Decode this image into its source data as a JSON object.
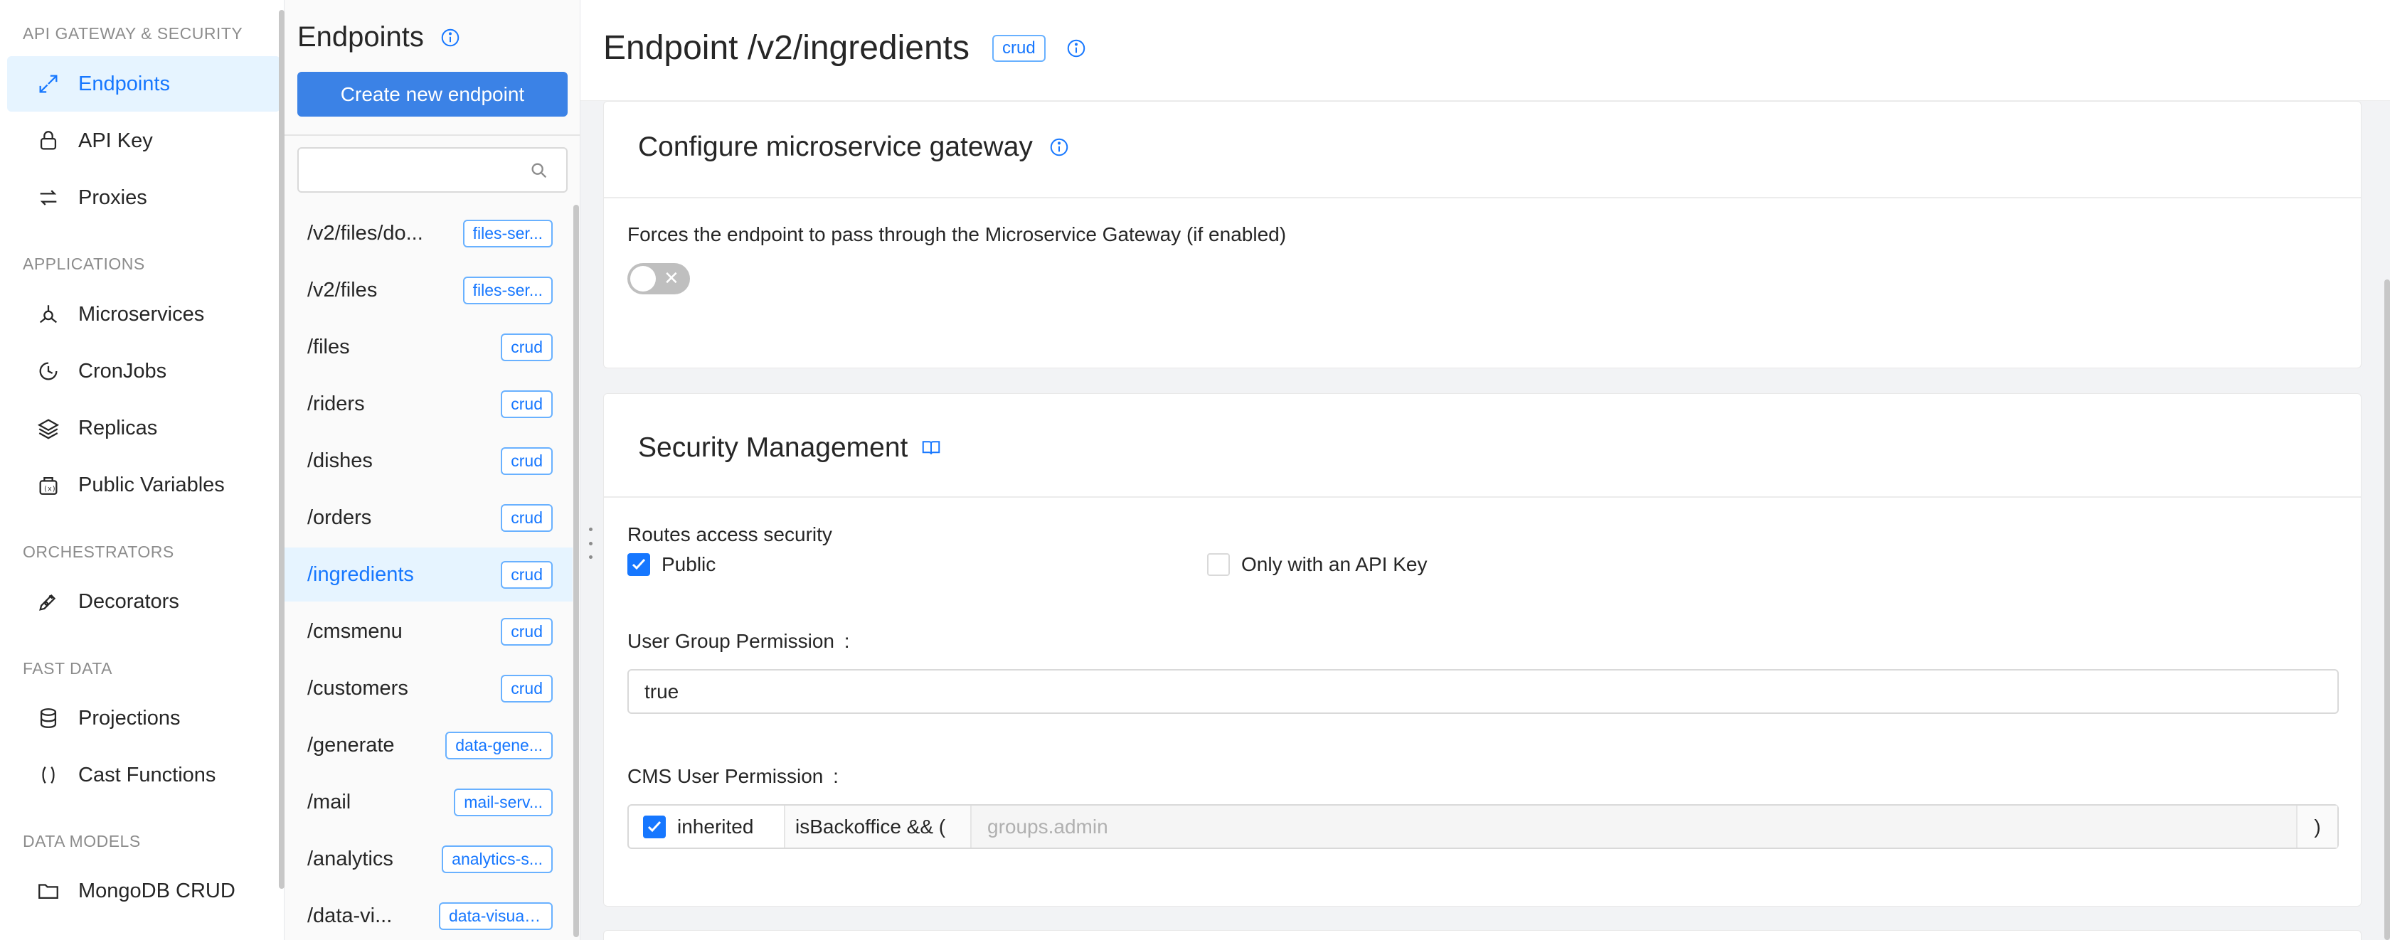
{
  "sidebar": {
    "sections": [
      {
        "title": "API GATEWAY & SECURITY",
        "items": [
          {
            "label": "Endpoints",
            "icon": "endpoints-icon",
            "active": true
          },
          {
            "label": "API Key",
            "icon": "lock-icon"
          },
          {
            "label": "Proxies",
            "icon": "proxies-icon"
          }
        ]
      },
      {
        "title": "APPLICATIONS",
        "items": [
          {
            "label": "Microservices",
            "icon": "microservices-icon"
          },
          {
            "label": "CronJobs",
            "icon": "clock-icon"
          },
          {
            "label": "Replicas",
            "icon": "layers-icon"
          },
          {
            "label": "Public Variables",
            "icon": "variables-icon"
          }
        ]
      },
      {
        "title": "ORCHESTRATORS",
        "items": [
          {
            "label": "Decorators",
            "icon": "pen-icon"
          }
        ]
      },
      {
        "title": "FAST DATA",
        "items": [
          {
            "label": "Projections",
            "icon": "database-icon"
          },
          {
            "label": "Cast Functions",
            "icon": "parentheses-icon"
          }
        ]
      },
      {
        "title": "DATA MODELS",
        "items": [
          {
            "label": "MongoDB CRUD",
            "icon": "folder-icon"
          }
        ]
      }
    ]
  },
  "endpoints_panel": {
    "title": "Endpoints",
    "create_button": "Create new endpoint",
    "search_placeholder": "",
    "items": [
      {
        "path": "/v2/files/do...",
        "tag": "files-ser..."
      },
      {
        "path": "/v2/files",
        "tag": "files-ser..."
      },
      {
        "path": "/files",
        "tag": "crud"
      },
      {
        "path": "/riders",
        "tag": "crud"
      },
      {
        "path": "/dishes",
        "tag": "crud"
      },
      {
        "path": "/orders",
        "tag": "crud"
      },
      {
        "path": "/ingredients",
        "tag": "crud",
        "active": true
      },
      {
        "path": "/cmsmenu",
        "tag": "crud"
      },
      {
        "path": "/customers",
        "tag": "crud"
      },
      {
        "path": "/generate",
        "tag": "data-gene..."
      },
      {
        "path": "/mail",
        "tag": "mail-serv..."
      },
      {
        "path": "/analytics",
        "tag": "analytics-s..."
      },
      {
        "path": "/data-vi...",
        "tag": "data-visualizat..."
      }
    ]
  },
  "main": {
    "title": "Endpoint /v2/ingredients",
    "tag": "crud",
    "gateway_card": {
      "title": "Configure microservice gateway",
      "description": "Forces the endpoint to pass through the Microservice Gateway (if enabled)",
      "toggle_on": false,
      "toggle_glyph": "✕"
    },
    "security_card": {
      "title": "Security Management",
      "routes_label": "Routes access security",
      "public_label": "Public",
      "public_checked": true,
      "api_key_label": "Only with an API Key",
      "api_key_checked": false,
      "user_group_label": "User Group Permission",
      "user_group_value": "true",
      "cms_label": "CMS User Permission",
      "cms_inherited_label": "inherited",
      "cms_inherited_checked": true,
      "cms_prefix": "isBackoffice && (",
      "cms_placeholder": "groups.admin",
      "cms_suffix": ")",
      "label_colon": ":"
    }
  },
  "colors": {
    "accent": "#1677ff",
    "primary_button": "#3b82e6",
    "active_bg": "#e6f4ff"
  }
}
